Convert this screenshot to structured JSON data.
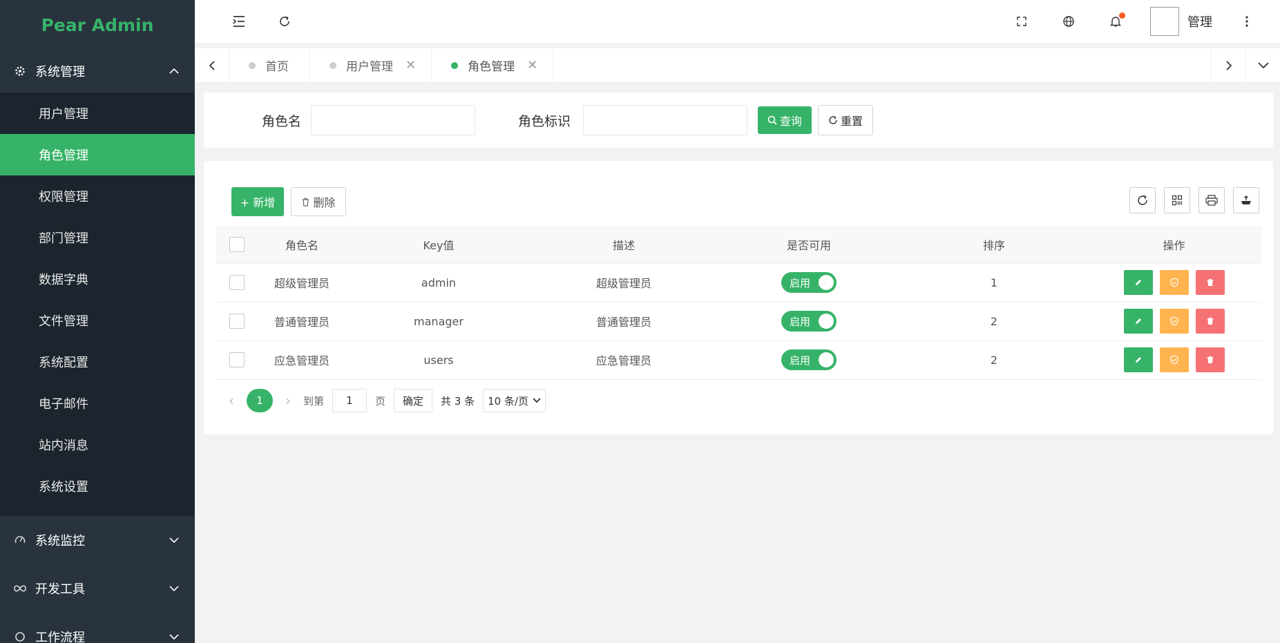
{
  "brand": {
    "name": "Pear Admin"
  },
  "sidebar": {
    "group_system": {
      "label": "系统管理"
    },
    "items": [
      {
        "label": "用户管理"
      },
      {
        "label": "角色管理",
        "active": true
      },
      {
        "label": "权限管理"
      },
      {
        "label": "部门管理"
      },
      {
        "label": "数据字典"
      },
      {
        "label": "文件管理"
      },
      {
        "label": "系统配置"
      },
      {
        "label": "电子邮件"
      },
      {
        "label": "站内消息"
      },
      {
        "label": "系统设置"
      }
    ],
    "group_monitor": {
      "label": "系统监控"
    },
    "group_devtools": {
      "label": "开发工具"
    },
    "group_workflow": {
      "label": "工作流程"
    }
  },
  "header": {
    "user_name": "管理",
    "icons": [
      "menu-fold-icon",
      "refresh-icon",
      "fullscreen-icon",
      "globe-icon",
      "bell-icon",
      "more-vertical-icon"
    ]
  },
  "tabs": [
    {
      "label": "首页",
      "closable": false
    },
    {
      "label": "用户管理",
      "closable": true
    },
    {
      "label": "角色管理",
      "closable": true,
      "active": true
    }
  ],
  "search": {
    "role_name_label": "角色名",
    "role_name_value": "",
    "role_key_label": "角色标识",
    "role_key_value": "",
    "query_label": "查询",
    "reset_label": "重置"
  },
  "toolbar": {
    "add_label": "+ 新增",
    "delete_label": "删除"
  },
  "table": {
    "headers": [
      "角色名",
      "Key值",
      "描述",
      "是否可用",
      "排序",
      "操作"
    ],
    "rows": [
      {
        "name": "超级管理员",
        "key": "admin",
        "desc": "超级管理员",
        "enabled_label": "启用",
        "sort": "1"
      },
      {
        "name": "普通管理员",
        "key": "manager",
        "desc": "普通管理员",
        "enabled_label": "启用",
        "sort": "2"
      },
      {
        "name": "应急管理员",
        "key": "users",
        "desc": "应急管理员",
        "enabled_label": "启用",
        "sort": "2"
      }
    ]
  },
  "pager": {
    "current": "1",
    "goto_label": "到第",
    "goto_value": "1",
    "page_label": "页",
    "confirm_label": "确定",
    "total_label": "共 3 条",
    "page_size_label": "10 条/页"
  },
  "colors": {
    "primary": "#36b368",
    "sidebar": "#28333e",
    "sidebar_sub": "#1c252d",
    "warning": "#ffb44f",
    "danger": "#f57174"
  }
}
